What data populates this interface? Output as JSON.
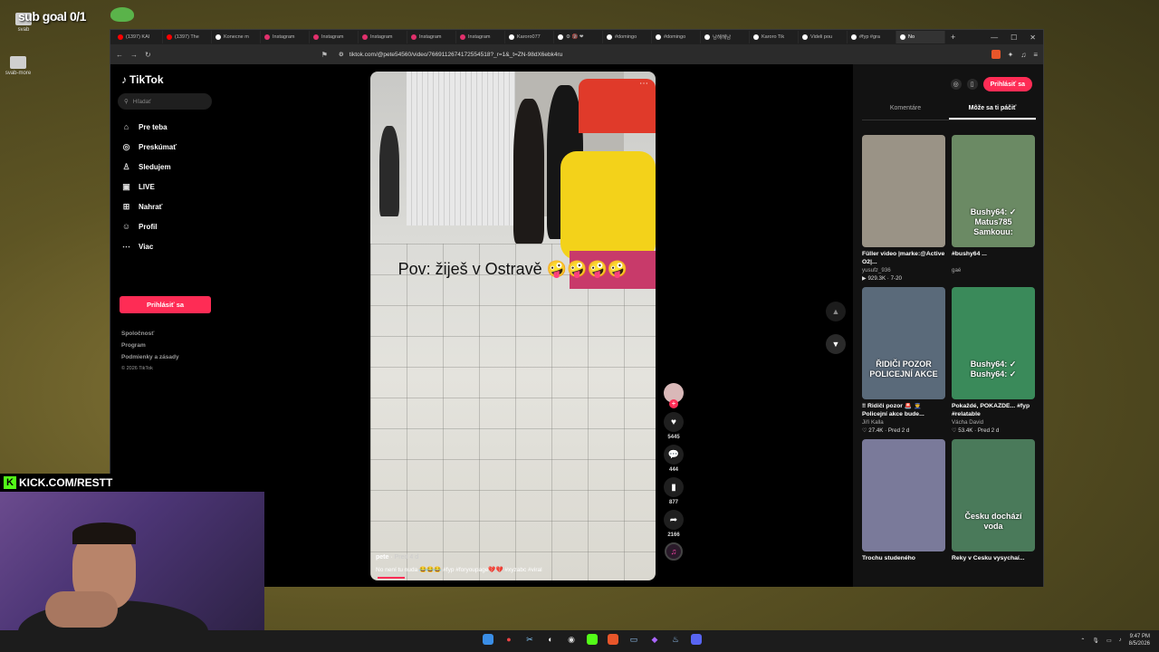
{
  "overlay": {
    "sub_goal": "sub goal 0/1",
    "desktop_icons": [
      "svab",
      "svab-more"
    ],
    "kick_text": "KICK.COM/RESTT"
  },
  "browser": {
    "tabs": [
      {
        "label": "(1397) KAI",
        "color": "#ff0000"
      },
      {
        "label": "(1397) The",
        "color": "#ff0000"
      },
      {
        "label": "Konecne m",
        "color": "#ffffff"
      },
      {
        "label": "Instagram",
        "color": "#e1306c"
      },
      {
        "label": "Instagram",
        "color": "#e1306c"
      },
      {
        "label": "Instagram",
        "color": "#e1306c"
      },
      {
        "label": "Instagram",
        "color": "#e1306c"
      },
      {
        "label": "Instagram",
        "color": "#e1306c"
      },
      {
        "label": "Karoro077",
        "color": "#ffffff"
      },
      {
        "label": "⚙ 🔞 ❤",
        "color": "#ffffff"
      },
      {
        "label": "#domingo",
        "color": "#ffffff"
      },
      {
        "label": "#domingo",
        "color": "#ffffff"
      },
      {
        "label": "남해해남",
        "color": "#ffffff"
      },
      {
        "label": "Karoro Tik",
        "color": "#ffffff"
      },
      {
        "label": "Videli pou",
        "color": "#ffffff"
      },
      {
        "label": "#fyp #gra",
        "color": "#ffffff"
      },
      {
        "label": "No",
        "color": "#ffffff"
      }
    ],
    "url": "tiktok.com/@pete54560/video/7669112674172554518?_r=1&_t=ZN-98dX6ebk4ru",
    "new_tab": "+"
  },
  "sidebar": {
    "logo": "TikTok",
    "search_placeholder": "Hľadať",
    "items": [
      {
        "icon": "⌂",
        "label": "Pre teba"
      },
      {
        "icon": "◎",
        "label": "Preskúmať"
      },
      {
        "icon": "♙",
        "label": "Sledujem"
      },
      {
        "icon": "▣",
        "label": "LIVE"
      },
      {
        "icon": "⊞",
        "label": "Nahrať"
      },
      {
        "icon": "☺",
        "label": "Profil"
      },
      {
        "icon": "⋯",
        "label": "Viac"
      }
    ],
    "login": "Prihlásiť sa",
    "footer": [
      "Spoločnosť",
      "Program",
      "Podmienky a zásady"
    ],
    "copyright": "© 2026 TikTok"
  },
  "video": {
    "overlay_caption": "Pov: žiješ v Ostravě 🤪🤪🤪🤪",
    "author": "pete",
    "posted": "Pred 4 d",
    "description": "No není tu nuda 😂😂😂 #fyp #foryoupage💔💔 #xyzabc #viral",
    "likes": "5445",
    "comments": "444",
    "saves": "877",
    "shares": "2166"
  },
  "right_panel": {
    "login": "Prihlásiť sa",
    "tabs": [
      "Komentáre",
      "Môže sa ti páčiť"
    ],
    "cards": [
      {
        "title": "Füller video |marke:@Active O2|...",
        "author": "yusufz_936",
        "stats": "▶ 929.3K · 7-20",
        "bg": "#9a9386"
      },
      {
        "title": "#bushy64 ...",
        "author": "gaé",
        "stats": "",
        "bg": "#6b8a64",
        "overlay": "Bushy64: ✓ Matus785 Samkouu:"
      },
      {
        "title": "‼ Řidiči pozor 🚨 👮 Policejní akce bude...",
        "author": "Jiří Kalla",
        "stats": "♡ 27.4K · Pred 2 d",
        "bg": "#5a6a7a",
        "overlay": "ŘIDIČI POZOR POLICEJNÍ AKCE"
      },
      {
        "title": "Pokaždé, POKAŽDÉ... #fyp #relatable",
        "author": "Vácha David",
        "stats": "♡ 53.4K · Pred 2 d",
        "bg": "#3a8a5a",
        "overlay": "Bushy64: ✓ Bushy64: ✓"
      },
      {
        "title": "Trochu studeného",
        "author": "",
        "stats": "",
        "bg": "#7a7a9a"
      },
      {
        "title": "Řeky v Česku vysychaí...",
        "author": "",
        "stats": "",
        "bg": "#4a7a5a",
        "overlay": "Česku dochází voda"
      }
    ]
  },
  "taskbar": {
    "time": "9:47 PM",
    "date": "8/5/2026"
  }
}
